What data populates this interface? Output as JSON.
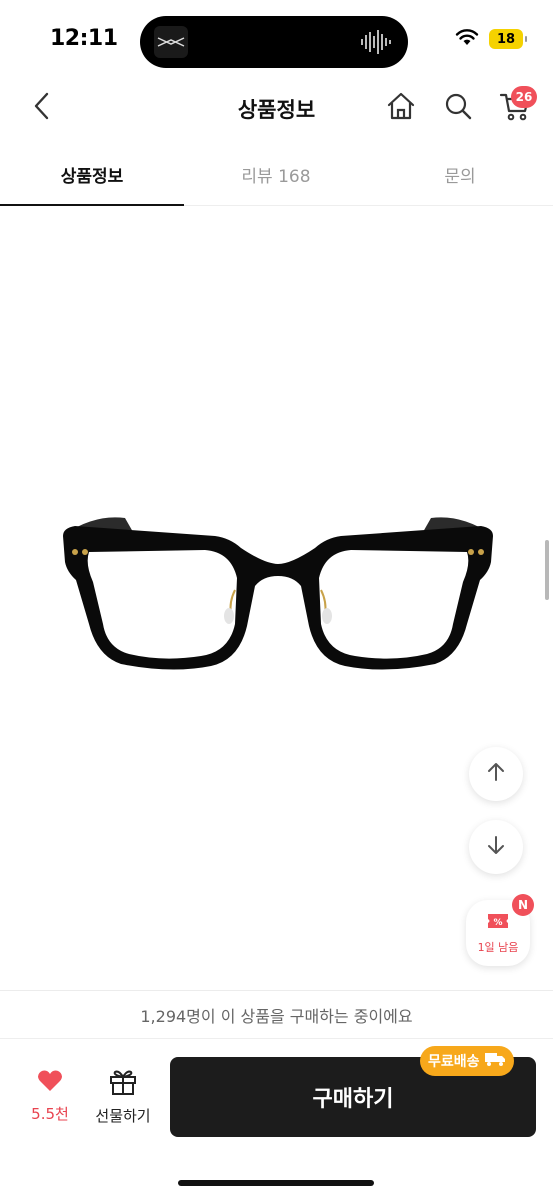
{
  "status_bar": {
    "time": "12:11",
    "battery": "18",
    "icons": [
      "wifi-icon",
      "battery-icon",
      "sound-wave-icon"
    ]
  },
  "header": {
    "title": "상품정보",
    "cart_count": "26",
    "icons": [
      "chevron-left-icon",
      "home-icon",
      "search-icon",
      "cart-icon"
    ]
  },
  "tabs": [
    {
      "label": "상품정보",
      "active": true
    },
    {
      "label": "리뷰 168",
      "active": false
    },
    {
      "label": "문의",
      "active": false
    }
  ],
  "product": {
    "image": "black-eyeglasses-image"
  },
  "floating": {
    "coupon_label": "1일 남음",
    "coupon_badge": "N"
  },
  "buyers_notice": "1,294명이 이 상품을 구매하는 중이에요",
  "bottom_bar": {
    "like_count": "5.5천",
    "gift_label": "선물하기",
    "buy_label": "구매하기",
    "free_shipping_label": "무료배송"
  },
  "colors": {
    "accent_red": "#f0505a",
    "buy_button": "#1c1c1c",
    "free_shipping": "#f7a81b"
  }
}
